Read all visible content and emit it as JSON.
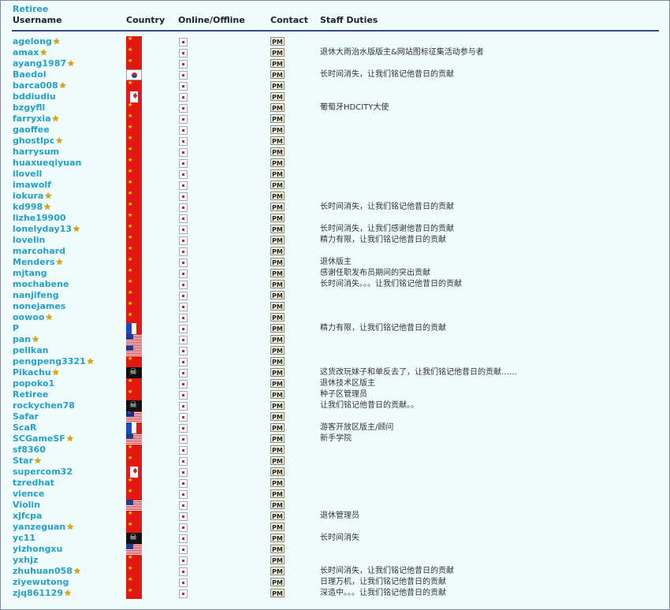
{
  "group_title": "Retiree",
  "headers": {
    "username": "Username",
    "country": "Country",
    "online": "Online/Offline",
    "contact": "Contact",
    "duties": "Staff Duties"
  },
  "pm_label": "PM",
  "star_icon": "star-icon",
  "colors": {
    "link": "#25a0c8",
    "background": "#eefcfc",
    "header_rule": "#3a4a7a",
    "star": "#e4a400"
  },
  "rows": [
    {
      "user": "agelong",
      "star": true,
      "country": "cn",
      "duty": ""
    },
    {
      "user": "amax",
      "star": true,
      "country": "cn",
      "duty": "退休大雨治水版版主&网站图标征集活动参与者"
    },
    {
      "user": "ayang1987",
      "star": true,
      "country": "cn",
      "duty": ""
    },
    {
      "user": "Baedol",
      "star": false,
      "country": "kr",
      "duty": "长时间消失，让我们铭记他昔日的贡献"
    },
    {
      "user": "barca008",
      "star": true,
      "country": "cn",
      "duty": ""
    },
    {
      "user": "bddiudiu",
      "star": false,
      "country": "ca",
      "duty": ""
    },
    {
      "user": "bzgyfll",
      "star": false,
      "country": "cn",
      "duty": "葡萄牙HDCITY大使"
    },
    {
      "user": "farryxia",
      "star": true,
      "country": "cn",
      "duty": ""
    },
    {
      "user": "gaoffee",
      "star": false,
      "country": "cn",
      "duty": ""
    },
    {
      "user": "ghostlpc",
      "star": true,
      "country": "cn",
      "duty": ""
    },
    {
      "user": "harrysum",
      "star": false,
      "country": "cn",
      "duty": ""
    },
    {
      "user": "huaxueqiyuan",
      "star": false,
      "country": "cn",
      "duty": ""
    },
    {
      "user": "ilovell",
      "star": false,
      "country": "cn",
      "duty": ""
    },
    {
      "user": "imawolf",
      "star": false,
      "country": "cn",
      "duty": ""
    },
    {
      "user": "iokura",
      "star": true,
      "country": "cn",
      "duty": ""
    },
    {
      "user": "kd998",
      "star": true,
      "country": "cn",
      "duty": "长时间消失，让我们铭记他昔日的贡献"
    },
    {
      "user": "lizhe19900",
      "star": false,
      "country": "cn",
      "duty": ""
    },
    {
      "user": "lonelyday13",
      "star": true,
      "country": "cn",
      "duty": "长时间消失，让我们感谢他昔日的贡献"
    },
    {
      "user": "lovelin",
      "star": false,
      "country": "cn",
      "duty": "精力有限，让我们铭记他昔日的贡献"
    },
    {
      "user": "marcohard",
      "star": false,
      "country": "cn",
      "duty": ""
    },
    {
      "user": "Menders",
      "star": true,
      "country": "cn",
      "duty": "退休版主"
    },
    {
      "user": "mjtang",
      "star": false,
      "country": "cn",
      "duty": "感谢任职发布员期间的突出贡献"
    },
    {
      "user": "mochabene",
      "star": false,
      "country": "cn",
      "duty": "长时间消失。。。让我们铭记他昔日的贡献"
    },
    {
      "user": "nanjifeng",
      "star": false,
      "country": "cn",
      "duty": ""
    },
    {
      "user": "nonejames",
      "star": false,
      "country": "cn",
      "duty": ""
    },
    {
      "user": "oowoo",
      "star": true,
      "country": "cn",
      "duty": ""
    },
    {
      "user": "P",
      "star": false,
      "country": "fr",
      "duty": "精力有限，让我们铭记他昔日的贡献"
    },
    {
      "user": "pan",
      "star": true,
      "country": "us",
      "duty": ""
    },
    {
      "user": "pelikan",
      "star": false,
      "country": "us",
      "duty": ""
    },
    {
      "user": "pengpeng3321",
      "star": true,
      "country": "cn",
      "duty": ""
    },
    {
      "user": "Pikachu",
      "star": true,
      "country": "pirate",
      "duty": "这货改玩妹子和单反去了，让我们铭记他昔日的贡献……"
    },
    {
      "user": "popoko1",
      "star": false,
      "country": "cn",
      "duty": "退休技术区版主"
    },
    {
      "user": "Retiree",
      "star": false,
      "country": "cn",
      "duty": "种子区管理员"
    },
    {
      "user": "rockychen78",
      "star": false,
      "country": "pirate",
      "duty": "让我们铭记他昔日的贡献。。"
    },
    {
      "user": "Safar",
      "star": false,
      "country": "my",
      "duty": ""
    },
    {
      "user": "ScaR",
      "star": false,
      "country": "fr",
      "duty": "游客开放区版主/顾问"
    },
    {
      "user": "SCGameSF",
      "star": true,
      "country": "us",
      "duty": "新手学院"
    },
    {
      "user": "sf8360",
      "star": false,
      "country": "cn",
      "duty": ""
    },
    {
      "user": "Star",
      "star": true,
      "country": "cn",
      "duty": ""
    },
    {
      "user": "supercom32",
      "star": false,
      "country": "ca",
      "duty": ""
    },
    {
      "user": "tzredhat",
      "star": false,
      "country": "cn",
      "duty": ""
    },
    {
      "user": "vience",
      "star": false,
      "country": "cn",
      "duty": ""
    },
    {
      "user": "Violin",
      "star": false,
      "country": "us",
      "duty": ""
    },
    {
      "user": "xjfcpa",
      "star": false,
      "country": "cn",
      "duty": "退休管理员"
    },
    {
      "user": "yanzeguan",
      "star": true,
      "country": "cn",
      "duty": ""
    },
    {
      "user": "yc11",
      "star": false,
      "country": "pirate",
      "duty": "长时间消失"
    },
    {
      "user": "yizhongxu",
      "star": false,
      "country": "us",
      "duty": ""
    },
    {
      "user": "yxhjz",
      "star": false,
      "country": "cn",
      "duty": ""
    },
    {
      "user": "zhuhuan058",
      "star": true,
      "country": "cn",
      "duty": "长时间消失，让我们铭记他昔日的贡献"
    },
    {
      "user": "ziyewutong",
      "star": false,
      "country": "cn",
      "duty": "日理万机，让我们铭记他昔日的贡献"
    },
    {
      "user": "zjq861129",
      "star": true,
      "country": "cn",
      "duty": "深造中。。。让我们铭记他昔日的贡献"
    }
  ]
}
